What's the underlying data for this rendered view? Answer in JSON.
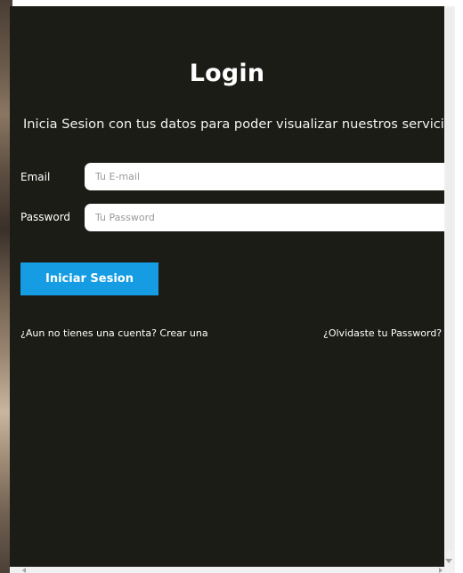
{
  "login": {
    "title": "Login",
    "subtitle": "Inicia Sesion con tus datos para poder visualizar nuestros servicios",
    "email_label": "Email",
    "email_placeholder": "Tu E-mail",
    "email_value": "",
    "password_label": "Password",
    "password_placeholder": "Tu Password",
    "password_value": "",
    "submit_label": "Iniciar Sesion",
    "signup_link": "¿Aun no tienes una cuenta? Crear una",
    "forgot_link": "¿Olvidaste tu Password?"
  },
  "colors": {
    "panel_background": "#1c1c17",
    "button_accent": "#169ce3",
    "text": "#ffffff"
  },
  "icons": {
    "scroll_down": "chevron-down-icon",
    "scroll_left": "chevron-left-icon",
    "scroll_right": "chevron-right-icon"
  }
}
